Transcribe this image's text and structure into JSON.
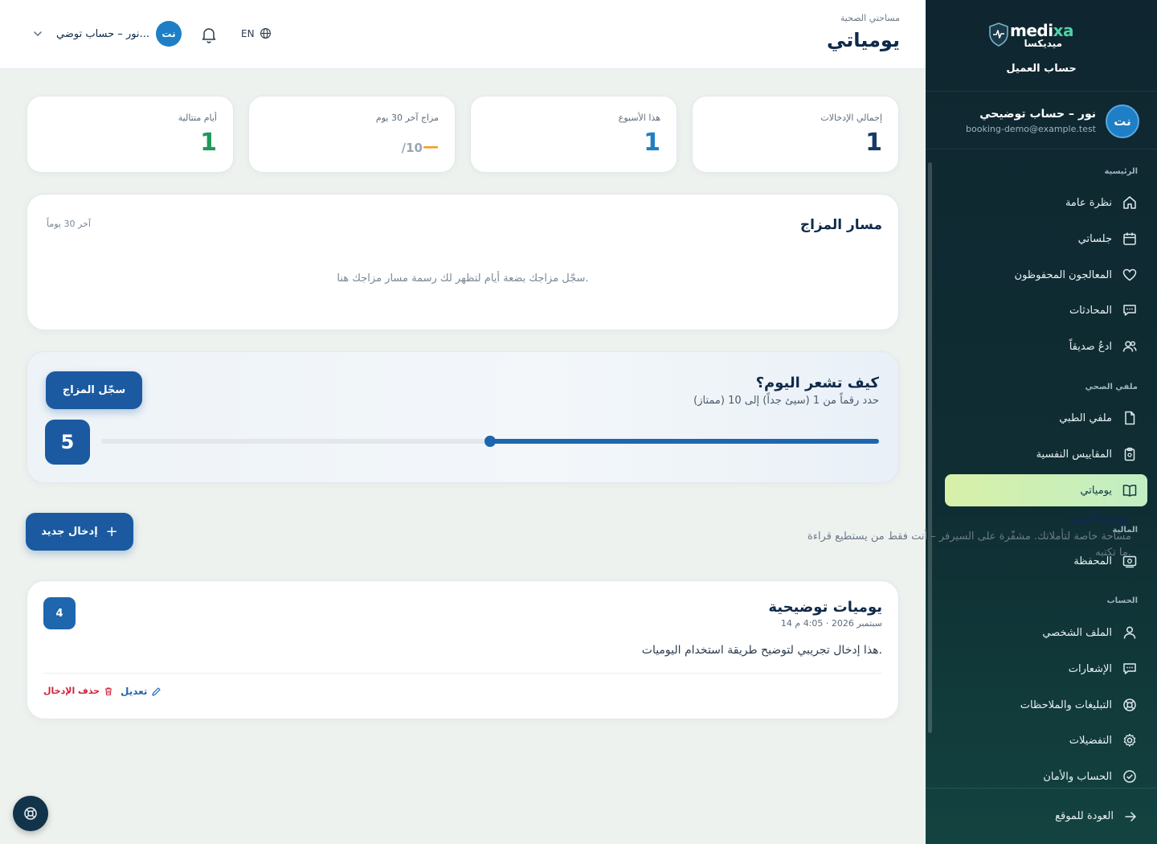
{
  "brand": {
    "name_main": "medi",
    "name_accent": "xa",
    "name_ar": "ميديكسا",
    "subtitle": "حساب العميل"
  },
  "user": {
    "initials": "نت",
    "name": "نور – حساب توضيحي",
    "email": "booking-demo@example.test"
  },
  "nav": {
    "sections": {
      "main": "الرئيسية",
      "health": "ملفي الصحي",
      "finance": "المالية",
      "account": "الحساب"
    },
    "items": [
      {
        "label": "نظرة عامة",
        "icon": "home-icon"
      },
      {
        "label": "جلساتي",
        "icon": "calendar-icon"
      },
      {
        "label": "المعالجون المحفوظون",
        "icon": "heart-icon"
      },
      {
        "label": "المحادثات",
        "icon": "chat-icon"
      },
      {
        "label": "ادعُ صديقاً",
        "icon": "users-icon"
      },
      {
        "label": "ملفي الطبي",
        "icon": "file-icon"
      },
      {
        "label": "المقاييس النفسية",
        "icon": "clipboard-icon"
      },
      {
        "label": "يومياتي",
        "icon": "book-icon",
        "active": true
      },
      {
        "label": "المحفظة",
        "icon": "wallet-icon"
      },
      {
        "label": "الملف الشخصي",
        "icon": "user-icon"
      },
      {
        "label": "الإشعارات",
        "icon": "message-icon"
      },
      {
        "label": "التبليغات والملاحظات",
        "icon": "lifebuoy-icon"
      },
      {
        "label": "التفضيلات",
        "icon": "gear-icon"
      },
      {
        "label": "الحساب والأمان",
        "icon": "shield-check-icon"
      }
    ],
    "back": "العودة للموقع"
  },
  "topbar": {
    "breadcrumb": "مساحتي الصحية",
    "title": "يومياتي",
    "user_short": "نور – حساب توضي...",
    "lang": "EN"
  },
  "stats": [
    {
      "label": "إجمالي الإدخالات",
      "value": "1",
      "color": "#173a6a"
    },
    {
      "label": "هذا الأسبوع",
      "value": "1",
      "color": "#1e7fc6"
    },
    {
      "label": "مزاج آخر 30 يوم",
      "value": "—",
      "suffix": "/10",
      "color": "#f0a020"
    },
    {
      "label": "أيام متتالية",
      "value": "1",
      "color": "#1e9a5a"
    }
  ],
  "mood_trend": {
    "title": "مسار المزاج",
    "range": "آخر 30 يوماً",
    "empty": "سجّل مزاجك بضعة أيام لتظهر لك رسمة مسار مزاجك هنا."
  },
  "mood_log": {
    "title": "كيف تشعر اليوم؟",
    "hint": "حدد رقماً من 1 (سيئ جداً) إلى 10 (ممتاز)",
    "button": "سجّل المزاج",
    "value": "5",
    "level": 0.5
  },
  "journal": {
    "title": "يومياتي",
    "desc_line1": "مساحة خاصة لتأملاتك. مشفّرة على السيرفر – أنت فقط من يستطيع قراءة",
    "desc_line2": "ما تكتبه.",
    "new_button": "إدخال جديد",
    "entries": [
      {
        "title": "يوميات توضيحية",
        "date": "14 سبتمبر 2026 · 4:05 م",
        "body": "هذا إدخال تجريبي لتوضيح طريقة استخدام اليوميات.",
        "mood": "4",
        "edit": "تعديل",
        "delete": "حذف الإدخال"
      }
    ]
  },
  "colors": {
    "primary": "#1b5aa0",
    "danger": "#d0223a",
    "sidebar": "#0f2630",
    "active": "#d7f0a8"
  }
}
